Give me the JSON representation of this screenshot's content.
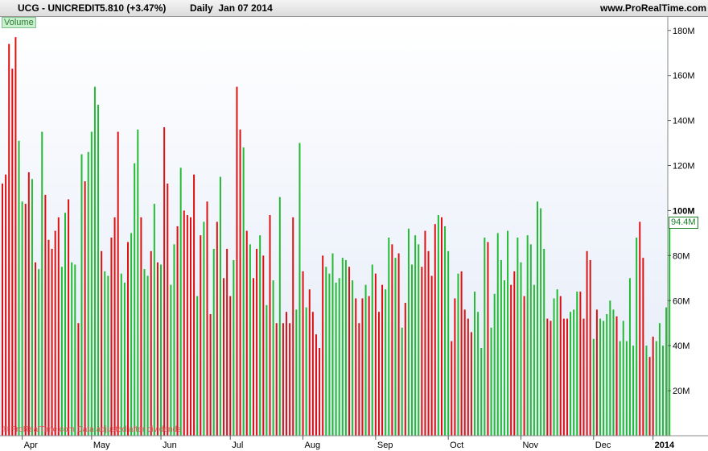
{
  "header": {
    "symbol": "UCG - UNICREDIT",
    "price": "5.810 (+3.47%)",
    "period": "Daily  Jan 07 2014",
    "site": "www.ProRealTime.com"
  },
  "panel_label": "Volume",
  "last_value_label": "94.4M",
  "watermark": "© ProRealTime.com  Data adjusted after dividends",
  "colors": {
    "up": "#22bb33",
    "down": "#dd1111",
    "background_top": "#ffffff",
    "background_bottom": "#e3eaf8"
  },
  "chart_data": {
    "type": "bar",
    "title": "",
    "xlabel": "",
    "ylabel": "",
    "ylim": [
      0,
      186
    ],
    "unit": "M",
    "y_ticks": [
      "20M",
      "40M",
      "60M",
      "80M",
      "100M",
      "120M",
      "140M",
      "160M",
      "180M"
    ],
    "x_ticks": [
      "Apr",
      "May",
      "Jun",
      "Jul",
      "Aug",
      "Sep",
      "Oct",
      "Nov",
      "Dec",
      "2014"
    ],
    "x_tick_session_index": [
      6,
      27,
      48,
      69,
      91,
      113,
      135,
      157,
      179,
      197
    ],
    "series": [
      {
        "values": [
          112,
          116,
          174,
          163,
          177,
          131,
          104,
          103,
          117,
          114,
          77,
          74,
          135,
          107,
          87,
          83,
          91,
          97,
          75,
          99,
          105,
          77,
          76,
          50,
          125,
          113,
          126,
          135,
          155,
          147,
          82,
          73,
          71,
          88,
          97,
          135,
          72,
          68,
          86,
          90,
          121,
          136,
          97,
          74,
          71,
          82,
          103,
          77,
          76,
          137,
          112,
          67,
          85,
          93,
          119,
          100,
          98,
          97,
          116,
          62,
          89,
          95,
          104,
          54,
          83,
          95,
          115,
          70,
          83,
          62,
          78,
          155,
          136,
          128,
          91,
          85,
          70,
          83,
          89,
          80,
          58,
          98,
          69,
          50,
          106,
          50,
          55,
          50,
          97,
          56,
          130,
          73,
          57,
          65,
          55,
          45,
          39,
          80,
          75,
          72,
          81,
          68,
          70,
          79,
          78,
          75,
          69,
          61,
          50,
          61,
          67,
          62,
          76,
          72,
          55,
          67,
          65,
          88,
          85,
          79,
          81,
          48,
          59,
          92,
          76,
          89,
          85,
          75,
          91,
          82,
          71,
          94,
          98,
          97,
          93,
          82,
          42,
          61,
          72,
          73,
          56,
          52,
          46,
          64,
          55,
          39,
          88,
          86,
          48,
          63,
          90,
          78,
          69,
          91,
          67,
          73,
          88,
          77,
          62,
          89,
          85,
          67,
          104,
          101,
          83,
          52,
          51,
          61,
          65,
          62,
          52,
          52,
          55,
          56,
          64,
          64,
          52,
          82,
          78,
          43,
          56,
          52,
          51,
          54,
          60,
          56,
          53,
          42,
          51,
          42,
          70,
          40,
          88,
          95,
          79,
          40,
          35,
          44,
          42,
          50,
          40,
          57,
          94.4
        ],
        "direction": [
          "d",
          "d",
          "d",
          "d",
          "d",
          "u",
          "u",
          "d",
          "d",
          "u",
          "d",
          "u",
          "u",
          "d",
          "d",
          "d",
          "d",
          "d",
          "u",
          "u",
          "d",
          "u",
          "u",
          "d",
          "u",
          "d",
          "u",
          "u",
          "u",
          "u",
          "d",
          "u",
          "u",
          "d",
          "d",
          "d",
          "u",
          "u",
          "d",
          "u",
          "u",
          "u",
          "d",
          "u",
          "u",
          "d",
          "u",
          "d",
          "u",
          "d",
          "d",
          "u",
          "u",
          "d",
          "u",
          "d",
          "d",
          "d",
          "d",
          "u",
          "d",
          "u",
          "d",
          "d",
          "u",
          "d",
          "u",
          "d",
          "d",
          "d",
          "u",
          "d",
          "d",
          "u",
          "d",
          "u",
          "d",
          "d",
          "u",
          "d",
          "u",
          "d",
          "u",
          "d",
          "u",
          "d",
          "d",
          "d",
          "d",
          "u",
          "u",
          "d",
          "u",
          "d",
          "d",
          "d",
          "d",
          "d",
          "u",
          "u",
          "u",
          "u",
          "u",
          "u",
          "u",
          "d",
          "u",
          "d",
          "d",
          "d",
          "u",
          "d",
          "u",
          "d",
          "d",
          "d",
          "u",
          "u",
          "d",
          "u",
          "d",
          "u",
          "d",
          "u",
          "u",
          "u",
          "u",
          "d",
          "d",
          "d",
          "d",
          "d",
          "u",
          "d",
          "u",
          "u",
          "d",
          "d",
          "u",
          "d",
          "d",
          "d",
          "d",
          "u",
          "u",
          "u",
          "u",
          "d",
          "u",
          "u",
          "u",
          "u",
          "u",
          "u",
          "d",
          "d",
          "u",
          "u",
          "d",
          "u",
          "u",
          "u",
          "u",
          "u",
          "u",
          "d",
          "d",
          "u",
          "u",
          "d",
          "d",
          "d",
          "u",
          "u",
          "u",
          "d",
          "d",
          "d",
          "d",
          "u",
          "d",
          "u",
          "u",
          "u",
          "u",
          "u",
          "d",
          "u",
          "u",
          "u",
          "u",
          "u",
          "u",
          "d",
          "d",
          "u",
          "d",
          "d",
          "u",
          "u",
          "u",
          "u",
          "u",
          "u",
          "u",
          "u",
          "d",
          "d"
        ]
      }
    ]
  }
}
